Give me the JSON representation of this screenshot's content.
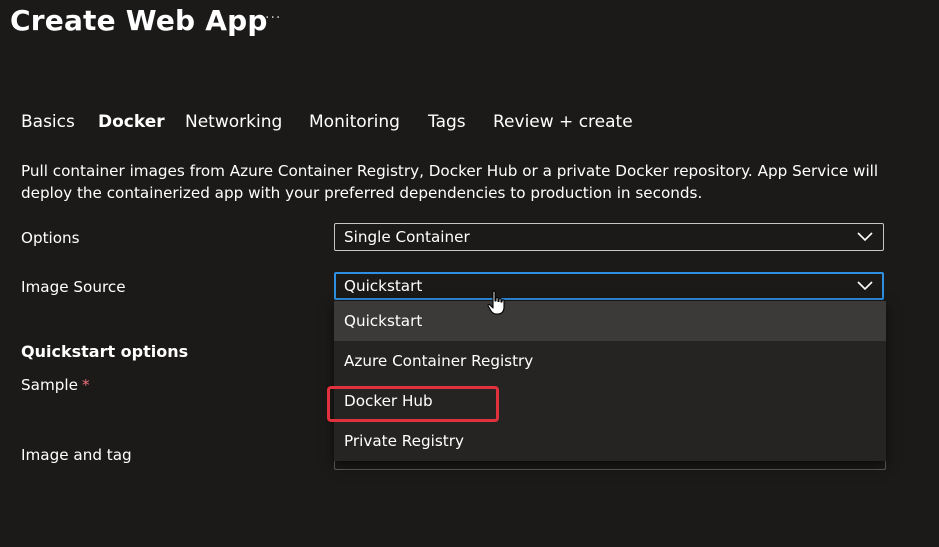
{
  "page": {
    "title": "Create Web App",
    "more_label": "···"
  },
  "tabs": [
    {
      "label": "Basics",
      "active": false
    },
    {
      "label": "Docker",
      "active": true
    },
    {
      "label": "Networking",
      "active": false
    },
    {
      "label": "Monitoring",
      "active": false
    },
    {
      "label": "Tags",
      "active": false
    },
    {
      "label": "Review + create",
      "active": false
    }
  ],
  "description": "Pull container images from Azure Container Registry, Docker Hub or a private Docker repository. App Service will deploy the containerized app with your preferred dependencies to production in seconds.",
  "form": {
    "options_label": "Options",
    "options_value": "Single Container",
    "image_source_label": "Image Source",
    "image_source_value": "Quickstart",
    "quickstart_section": "Quickstart options",
    "sample_label": "Sample",
    "required_marker": "*",
    "image_tag_label": "Image and tag"
  },
  "dropdown": {
    "options": [
      "Quickstart",
      "Azure Container Registry",
      "Docker Hub",
      "Private Registry"
    ],
    "selected": "Quickstart",
    "highlighted": "Docker Hub"
  },
  "colors": {
    "background": "#1b1a19",
    "focus_border": "#2f8fe0",
    "highlight": "#e0313d",
    "required": "#f1707b"
  },
  "icons": {
    "more": "more-icon",
    "chevron": "chevron-down-icon",
    "cursor": "hand-pointer-icon"
  }
}
